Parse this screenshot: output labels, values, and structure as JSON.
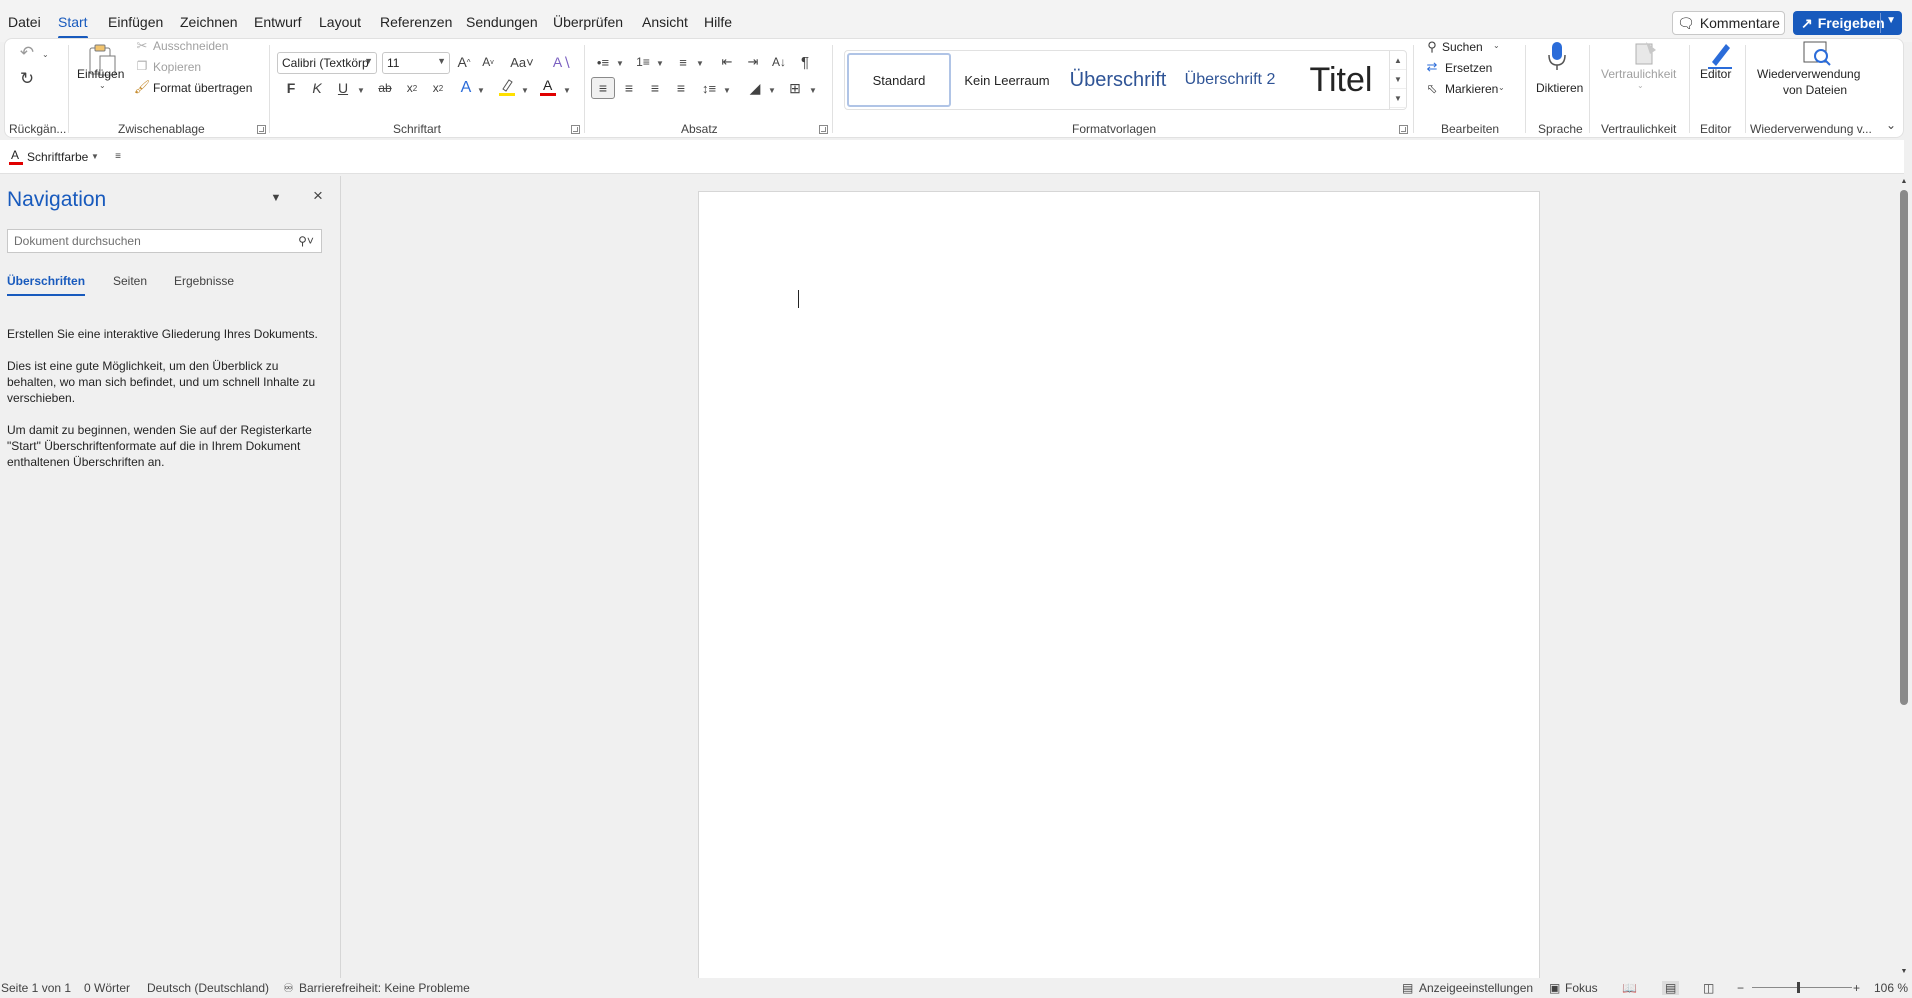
{
  "menubar": {
    "tabs": [
      "Datei",
      "Start",
      "Einfügen",
      "Zeichnen",
      "Entwurf",
      "Layout",
      "Referenzen",
      "Sendungen",
      "Überprüfen",
      "Ansicht",
      "Hilfe"
    ],
    "active_tab": "Start",
    "comments_label": "Kommentare",
    "share_label": "Freigeben"
  },
  "ribbon": {
    "undo": {
      "group_label": "Rückgän..."
    },
    "clipboard": {
      "paste_label": "Einfügen",
      "cut_label": "Ausschneiden",
      "copy_label": "Kopieren",
      "format_painter_label": "Format übertragen",
      "group_label": "Zwischenablage"
    },
    "font": {
      "font_name": "Calibri (Textkörp",
      "font_size": "11",
      "bold": "F",
      "italic": "K",
      "underline": "U",
      "group_label": "Schriftart"
    },
    "paragraph": {
      "group_label": "Absatz"
    },
    "styles": {
      "items": [
        "Standard",
        "Kein Leerraum",
        "Überschrift",
        "Überschrift 2",
        "Titel"
      ],
      "group_label": "Formatvorlagen"
    },
    "editing": {
      "find_label": "Suchen",
      "replace_label": "Ersetzen",
      "select_label": "Markieren",
      "group_label": "Bearbeiten"
    },
    "voice": {
      "dictate_label": "Diktieren",
      "group_label": "Sprache"
    },
    "sensitivity": {
      "label": "Vertraulichkeit",
      "group_label": "Vertraulichkeit"
    },
    "editor": {
      "label": "Editor",
      "group_label": "Editor"
    },
    "reuse": {
      "label_line1": "Wiederverwendung",
      "label_line2": "von Dateien",
      "group_label": "Wiederverwendung v..."
    }
  },
  "qat": {
    "font_color_label": "Schriftfarbe"
  },
  "navigation": {
    "title": "Navigation",
    "search_placeholder": "Dokument durchsuchen",
    "tabs": [
      "Überschriften",
      "Seiten",
      "Ergebnisse"
    ],
    "paragraphs": [
      "Erstellen Sie eine interaktive Gliederung Ihres Dokuments.",
      "Dies ist eine gute Möglichkeit, um den Überblick zu behalten, wo man sich befindet, und um schnell Inhalte zu verschieben.",
      "Um damit zu beginnen, wenden Sie auf der Registerkarte \"Start\" Überschriftenformate auf die in Ihrem Dokument enthaltenen Überschriften an."
    ]
  },
  "statusbar": {
    "page": "Seite 1 von 1",
    "words": "0 Wörter",
    "language": "Deutsch (Deutschland)",
    "accessibility": "Barrierefreiheit: Keine Probleme",
    "display_settings": "Anzeigeeinstellungen",
    "focus": "Fokus",
    "zoom": "106 %"
  },
  "colors": {
    "accent": "#185abd",
    "font_color_red": "#e00000",
    "highlight_yellow": "#ffe000"
  }
}
